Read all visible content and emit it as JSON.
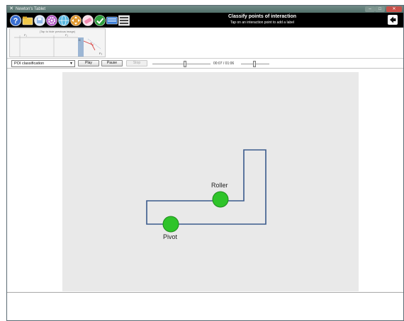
{
  "window": {
    "title": "Newton's Tablet"
  },
  "toolbar": {
    "tools": [
      {
        "icon": "help-icon",
        "color": "#3a6fd0"
      },
      {
        "icon": "folder-icon",
        "color": "#f0c84a"
      },
      {
        "icon": "save-icon",
        "color": "#8fb7e8"
      },
      {
        "icon": "gear-icon",
        "color": "#b55dc7"
      },
      {
        "icon": "globe-icon",
        "color": "#58b7e0"
      },
      {
        "icon": "move-icon",
        "color": "#e09a32"
      },
      {
        "icon": "eraser-icon",
        "color": "#f28bb0"
      },
      {
        "icon": "checkmark-icon",
        "color": "#2f9e3e"
      },
      {
        "icon": "keyboard-icon",
        "color": "#3c7fd8"
      },
      {
        "icon": "film-icon",
        "color": "#c8c8c8"
      }
    ],
    "instruction_title": "Classify points of interaction",
    "instruction_subtitle": "Tap on an interaction point to add a label",
    "back_icon": "arrow-left-icon"
  },
  "thumbnail": {
    "caption": "(Tap to hide previous image)"
  },
  "controls": {
    "mode_select": "POI classification",
    "play_label": "Play",
    "pause_label": "Pause",
    "stop_label": "Stop",
    "timecode": "00:07 / 01:06"
  },
  "canvas": {
    "poi": [
      {
        "label": "Roller",
        "color": "#2fc42a"
      },
      {
        "label": "Pivot",
        "color": "#2fc42a"
      }
    ],
    "shape_color": "#3a5a8c"
  }
}
